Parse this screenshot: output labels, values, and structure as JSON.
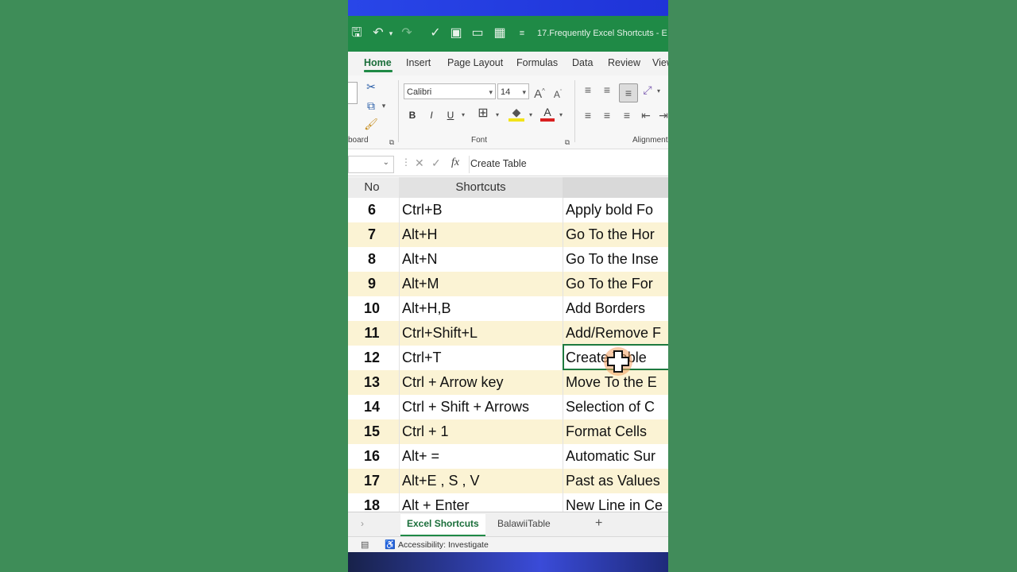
{
  "app": {
    "window_title": "17.Frequently Excel Shortcuts - E",
    "tabs": [
      "Home",
      "Insert",
      "Page Layout",
      "Formulas",
      "Data",
      "Review",
      "View"
    ],
    "active_tab": "Home"
  },
  "ribbon": {
    "font_name": "Calibri",
    "font_size": "14",
    "groups": {
      "clipboard": "board",
      "font": "Font",
      "alignment": "Alignment"
    }
  },
  "formula_bar": {
    "value": "Create Table",
    "fx": "fx"
  },
  "grid": {
    "headers": [
      "No",
      "Shortcuts",
      ""
    ],
    "rows": [
      {
        "no": "6",
        "shortcut": "Ctrl+B",
        "desc": "Apply bold Fo"
      },
      {
        "no": "7",
        "shortcut": "Alt+H",
        "desc": "Go To the Hor"
      },
      {
        "no": "8",
        "shortcut": "Alt+N",
        "desc": "Go To the Inse"
      },
      {
        "no": "9",
        "shortcut": "Alt+M",
        "desc": "Go To the For"
      },
      {
        "no": "10",
        "shortcut": "Alt+H,B",
        "desc": "Add Borders"
      },
      {
        "no": "11",
        "shortcut": "Ctrl+Shift+L",
        "desc": "Add/Remove F"
      },
      {
        "no": "12",
        "shortcut": "Ctrl+T",
        "desc": "Create Table"
      },
      {
        "no": "13",
        "shortcut": "Ctrl + Arrow key",
        "desc": "Move To the E"
      },
      {
        "no": "14",
        "shortcut": "Ctrl + Shift + Arrows",
        "desc": "Selection of C"
      },
      {
        "no": "15",
        "shortcut": "Ctrl + 1",
        "desc": "Format Cells"
      },
      {
        "no": "16",
        "shortcut": "Alt+ =",
        "desc": "Automatic Sur"
      },
      {
        "no": "17",
        "shortcut": "Alt+E , S , V",
        "desc": "Past as Values"
      },
      {
        "no": "18",
        "shortcut": "Alt + Enter",
        "desc": "New Line in Ce"
      }
    ]
  },
  "sheets": {
    "tabs": [
      "Excel Shortcuts",
      "BalawiiTable"
    ],
    "active": "Excel Shortcuts",
    "add": "+"
  },
  "status": {
    "accessibility": "Accessibility: Investigate"
  },
  "colors": {
    "excel_green": "#1f8a46",
    "band": "#fbf3d4",
    "background": "#3f8a57"
  }
}
